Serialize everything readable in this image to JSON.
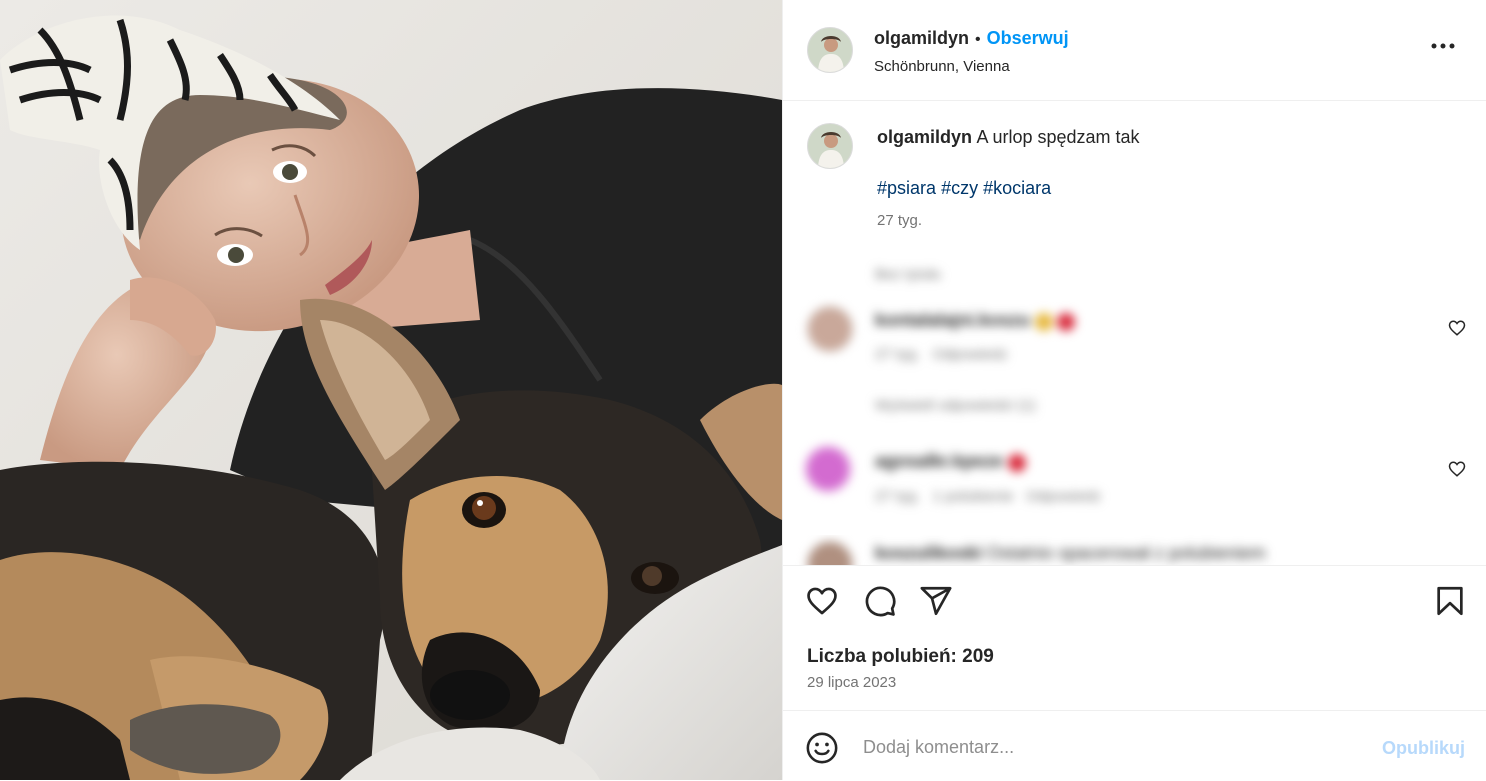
{
  "post": {
    "username": "olgamildyn",
    "follow_label": "Obserwuj",
    "location": "Schönbrunn, Vienna",
    "caption": {
      "username": "olgamildyn",
      "text": "A urlop spędzam tak",
      "hashtags": [
        "#psiara",
        "#czy",
        "#kociara"
      ],
      "age": "27 tyg."
    },
    "blurred_comments": [
      {
        "username": "kontalalajni.koszu",
        "meta": "27 tyg.   Odpowiedz"
      },
      {
        "username": "agosalkr.kpeze",
        "meta": "27 tyg.   1 polubienie   Odpowiedz"
      },
      {
        "username": "koszulikoski",
        "meta": "Ostatnio spacerował z polubieniem"
      }
    ],
    "replies_label": "Wyświetl odpowiedzi (1)",
    "hidden_label": "Bez tytułu",
    "likes_label": "Liczba polubień: 209",
    "date": "29 lipca 2023",
    "comment_placeholder": "Dodaj komentarz...",
    "publish_label": "Opublikuj"
  },
  "icons": {
    "more": "more-horizontal-icon",
    "like": "heart-icon",
    "comment": "comment-bubble-icon",
    "share": "paper-plane-icon",
    "save": "bookmark-icon",
    "emoji": "emoji-smile-icon"
  },
  "colors": {
    "link_blue": "#0095f6",
    "hashtag_blue": "#00376b",
    "publish_disabled": "#b7d9fb",
    "text_primary": "#262626",
    "text_secondary": "#737373"
  }
}
